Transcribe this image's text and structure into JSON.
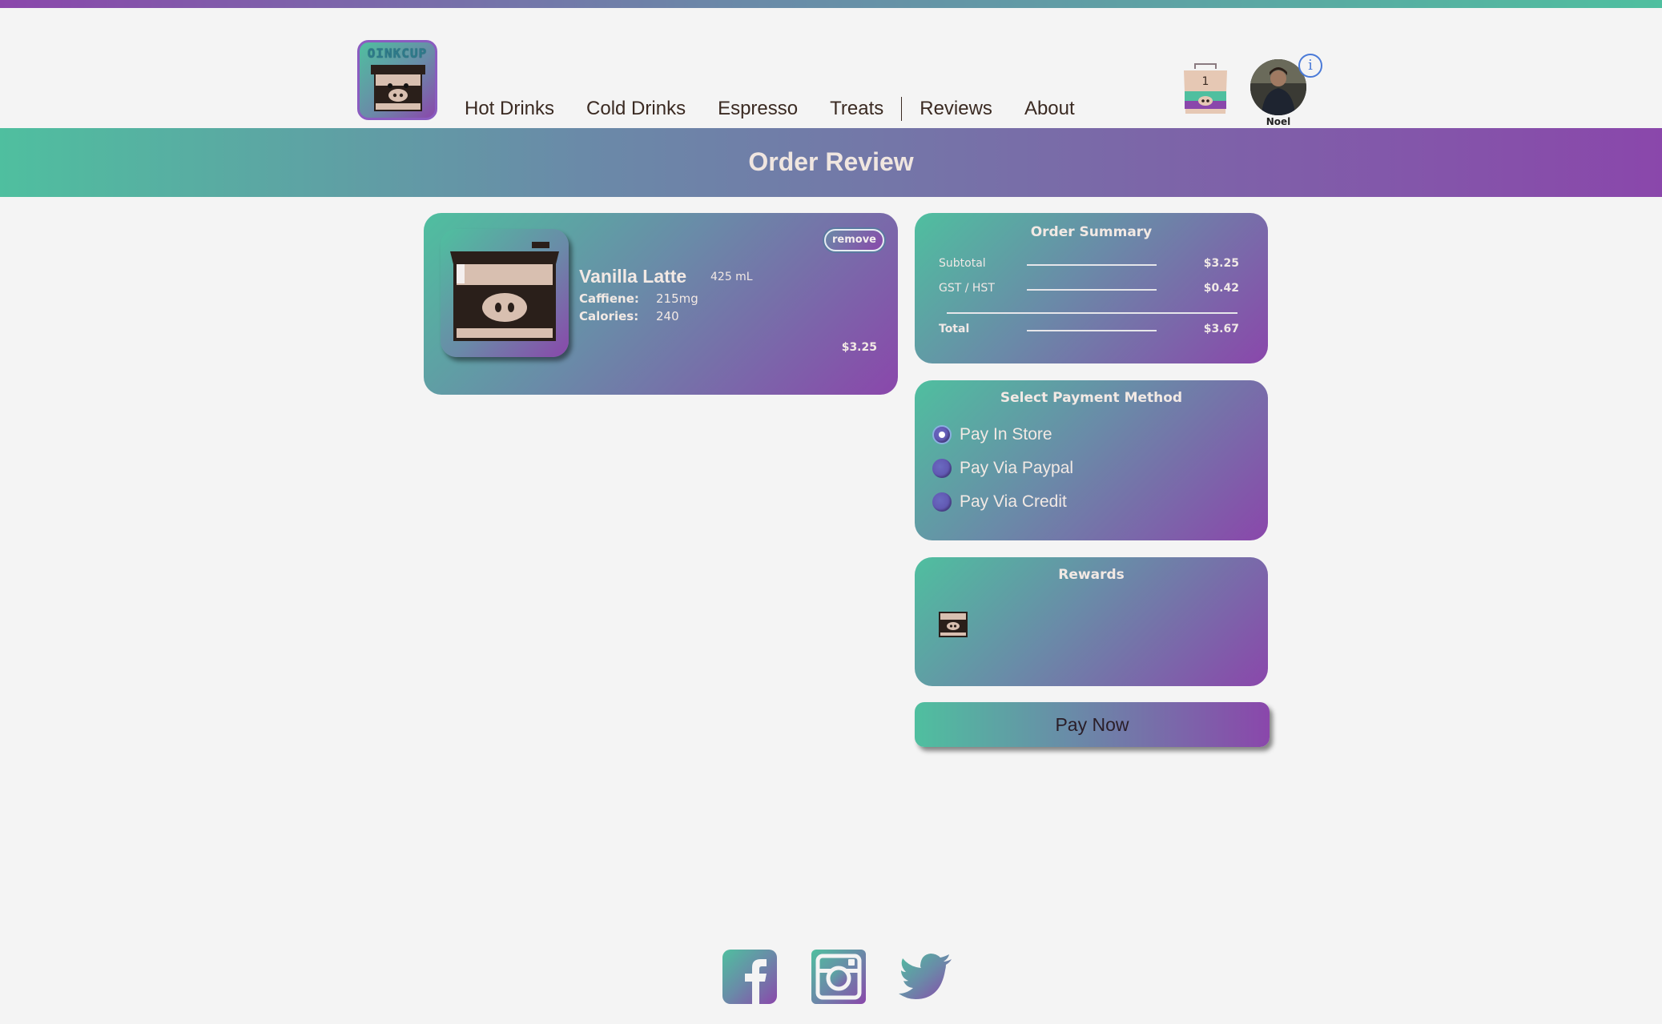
{
  "app": {
    "logo_text": "OINKCUP",
    "accent_colors": [
      "#4fbf9f",
      "#6a8aa8",
      "#8a47ab"
    ]
  },
  "nav": {
    "items": [
      "Hot Drinks",
      "Cold Drinks",
      "Espresso",
      "Treats",
      "Reviews",
      "About"
    ]
  },
  "header": {
    "cart_count": "1",
    "user_name": "Noel",
    "info_glyph": "i"
  },
  "page": {
    "title": "Order Review"
  },
  "cart": {
    "items": [
      {
        "name": "Vanilla Latte",
        "size": "425 mL",
        "caffeine_label": "Caffiene:",
        "caffeine_value": "215mg",
        "calories_label": "Calories:",
        "calories_value": "240",
        "price": "$3.25",
        "remove_label": "remove"
      }
    ]
  },
  "summary": {
    "title": "Order Summary",
    "rows": [
      {
        "label": "Subtotal",
        "value": "$3.25"
      },
      {
        "label": "GST / HST",
        "value": "$0.42"
      },
      {
        "label": "Total",
        "value": "$3.67"
      }
    ]
  },
  "payment": {
    "title": "Select Payment Method",
    "options": [
      "Pay In Store",
      "Pay Via Paypal",
      "Pay Via Credit"
    ],
    "selected": "Pay In Store"
  },
  "rewards": {
    "title": "Rewards",
    "icon": "cup-icon"
  },
  "actions": {
    "pay_now_label": "Pay Now"
  },
  "footer": {
    "social": [
      "facebook-icon",
      "instagram-icon",
      "twitter-icon"
    ]
  }
}
